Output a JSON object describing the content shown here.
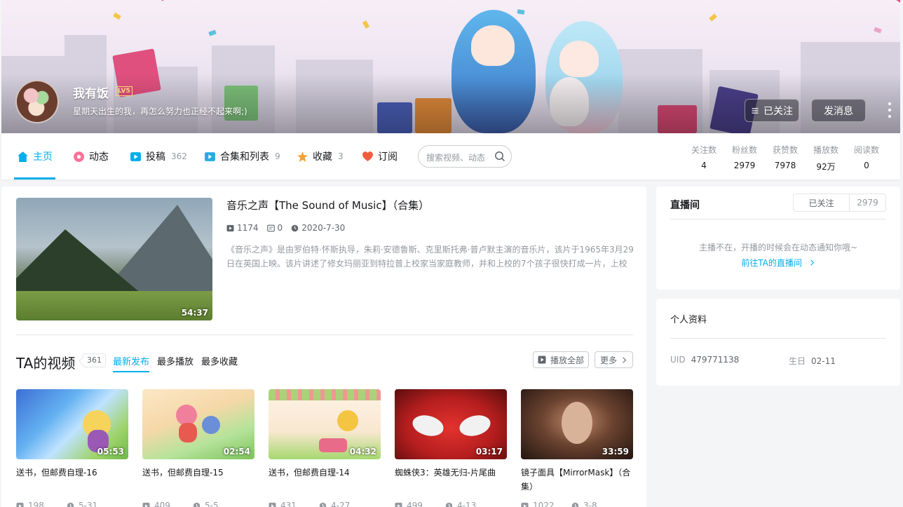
{
  "header": {
    "username": "我有饭",
    "level": "LV5",
    "signature": "星期天出生的我，再怎么努力也正经不起来啊;)",
    "follow_label": "已关注",
    "message_label": "发消息"
  },
  "nav": {
    "items": [
      {
        "label": "主页",
        "count": ""
      },
      {
        "label": "动态",
        "count": ""
      },
      {
        "label": "投稿",
        "count": "362"
      },
      {
        "label": "合集和列表",
        "count": "9"
      },
      {
        "label": "收藏",
        "count": "3"
      },
      {
        "label": "订阅",
        "count": ""
      }
    ],
    "search_placeholder": "搜索视频、动态"
  },
  "stats": [
    {
      "label": "关注数",
      "value": "4"
    },
    {
      "label": "粉丝数",
      "value": "2979"
    },
    {
      "label": "获赞数",
      "value": "7978"
    },
    {
      "label": "播放数",
      "value": "92万"
    },
    {
      "label": "阅读数",
      "value": "0"
    }
  ],
  "featured": {
    "title": "音乐之声【The Sound of Music】（合集）",
    "plays": "1174",
    "danmaku": "0",
    "date": "2020-7-30",
    "duration": "54:37",
    "description": "《音乐之声》是由罗伯特·怀斯执导，朱莉·安德鲁斯、克里斯托弗·普卢默主演的音乐片，该片于1965年3月29日在英国上映。该片讲述了修女玛丽亚到特拉普上校家当家庭教师，并和上校的7个孩子很快打成一片，上校"
  },
  "videos_section": {
    "title": "TA的视频",
    "count": "361",
    "tabs": [
      "最新发布",
      "最多播放",
      "最多收藏"
    ],
    "play_all_label": "播放全部",
    "more_label": "更多"
  },
  "videos": [
    {
      "title": "送书，但邮费自理-16",
      "duration": "05:53",
      "plays": "198",
      "date": "5-31"
    },
    {
      "title": "送书，但邮费自理-15",
      "duration": "02:54",
      "plays": "409",
      "date": "5-5"
    },
    {
      "title": "送书，但邮费自理-14",
      "duration": "04:32",
      "plays": "431",
      "date": "4-27"
    },
    {
      "title": "蜘蛛侠3：英雄无归-片尾曲",
      "duration": "03:17",
      "plays": "499",
      "date": "4-13"
    },
    {
      "title": "镜子面具【MirrorMask】（合集）",
      "duration": "33:59",
      "plays": "1022",
      "date": "3-8"
    }
  ],
  "live": {
    "title": "直播间",
    "follow_label": "已关注",
    "follow_count": "2979",
    "tip": "主播不在，开播的时候会在动态通知你哦~",
    "link": "前往TA的直播间"
  },
  "profile": {
    "title": "个人资料",
    "uid_label": "UID",
    "uid": "479771138",
    "birthday_label": "生日",
    "birthday": "02-11"
  },
  "colors": {
    "accent": "#00aeec",
    "ribbon": "#e04b7b"
  }
}
